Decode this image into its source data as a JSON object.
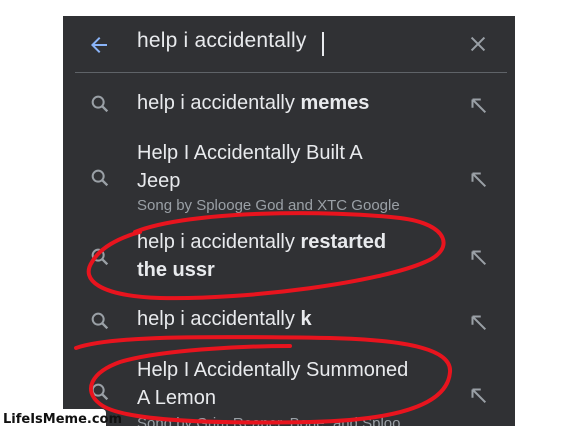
{
  "search": {
    "query": "help i accidentally",
    "back_icon": "arrow-left-icon",
    "clear_icon": "close-icon"
  },
  "suggestions": [
    {
      "text_plain": "help i accidentally ",
      "text_bold": "memes",
      "icon": "search-icon",
      "action_icon": "arrow-up-left-icon"
    },
    {
      "line1": "Help I Accidentally Built A",
      "line2": "Jeep",
      "subtitle": "Song by Splooge God and XTC Google",
      "icon": "search-icon",
      "action_icon": "arrow-up-left-icon"
    },
    {
      "line1_plain": "help i accidentally ",
      "line1_bold": "restarted",
      "line2_bold": "the ussr",
      "icon": "search-icon",
      "action_icon": "arrow-up-left-icon"
    },
    {
      "text_plain": "help i accidentally ",
      "text_bold": "k",
      "icon": "search-icon",
      "action_icon": "arrow-up-left-icon"
    },
    {
      "line1": "Help I Accidentally Summoned",
      "line2": "A Lemon",
      "subtitle": "Song by Grim Reaper, Bone, and Sploo",
      "icon": "search-icon",
      "action_icon": "arrow-up-left-icon"
    }
  ],
  "annotation_color": "#e8141e",
  "theme": {
    "background": "#303134",
    "text": "#e8eaed",
    "subtext": "#9aa0a6",
    "accent": "#8ab4f8"
  },
  "watermark": "LifeIsMeme.com"
}
